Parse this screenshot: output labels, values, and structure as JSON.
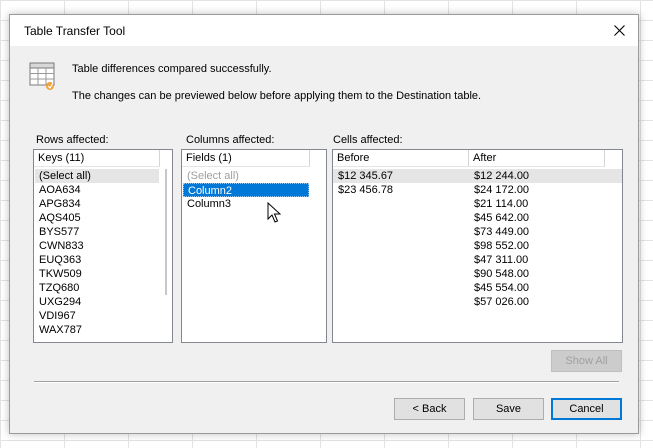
{
  "dialog": {
    "title": "Table Transfer Tool",
    "message_line1": "Table differences compared successfully.",
    "message_line2": "The changes can be previewed below before applying them to the Destination table."
  },
  "rows": {
    "label": "Rows affected:",
    "header": "Keys (11)",
    "items": [
      "(Select all)",
      "AOA634",
      "APG834",
      "AQS405",
      "BYS577",
      "CWN833",
      "EUQ363",
      "TKW509",
      "TZQ680",
      "UXG294",
      "VDI967",
      "WAX787"
    ]
  },
  "columns": {
    "label": "Columns affected:",
    "header": "Fields (1)",
    "items": [
      "(Select all)",
      "Column2",
      "Column3"
    ],
    "selected": "Column2"
  },
  "cells": {
    "label": "Cells affected:",
    "headers": [
      "Before",
      "After"
    ],
    "before": [
      "$12 345.67",
      "$23 456.78"
    ],
    "after": [
      "$12 244.00",
      "$24 172.00",
      "$21 114.00",
      "$45 642.00",
      "$73 449.00",
      "$98 552.00",
      "$47 311.00",
      "$90 548.00",
      "$45 554.00",
      "$57 026.00"
    ]
  },
  "buttons": {
    "show_all": "Show All",
    "back": "< Back",
    "save": "Save",
    "cancel": "Cancel"
  },
  "icons": {
    "close": "close-icon",
    "header": "table-icon",
    "cursor": "mouse-pointer-icon"
  }
}
